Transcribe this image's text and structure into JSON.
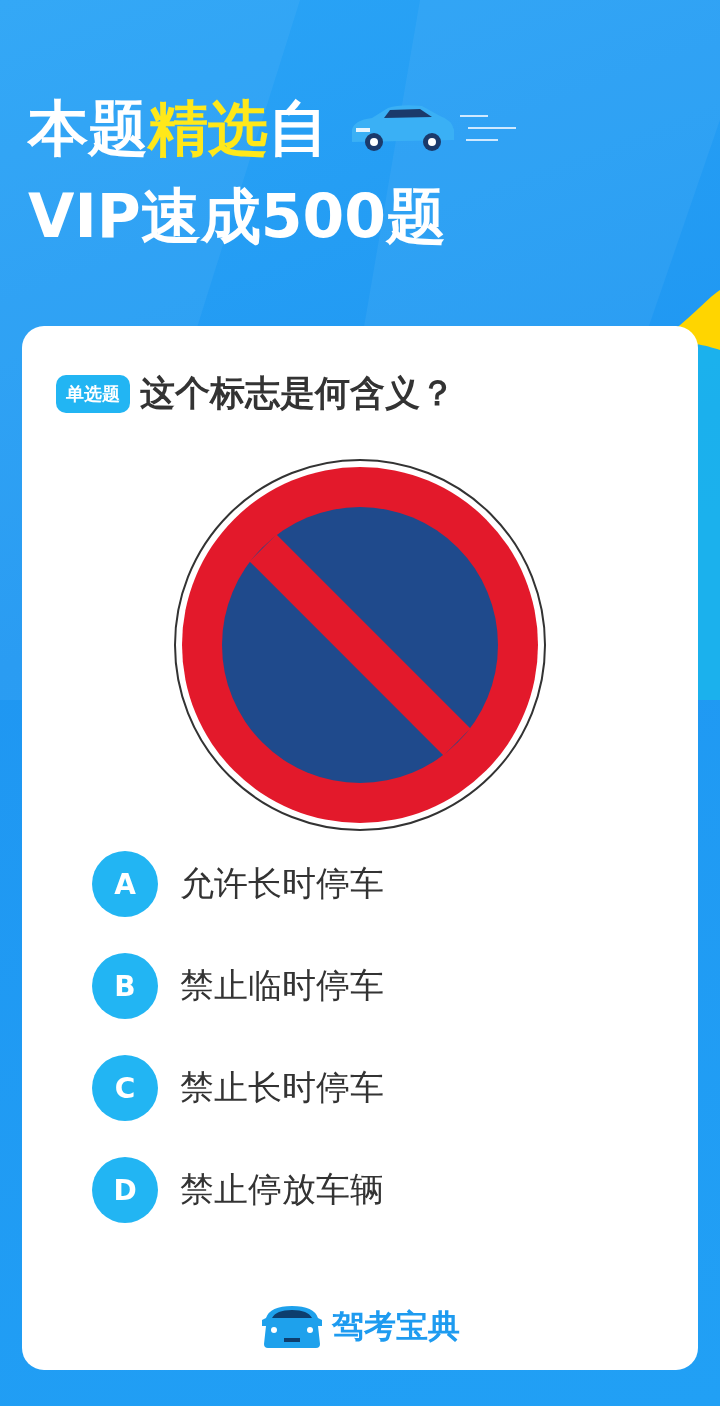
{
  "header": {
    "title_lines": [
      "本题**精选**自",
      "VIP速成500题"
    ]
  },
  "question": {
    "type_badge": "单选题",
    "text": "这个标志是何含义？"
  },
  "options": [
    {
      "letter": "A",
      "text": "允许长时停车",
      "selected": false
    },
    {
      "letter": "B",
      "text": "禁止临时停车",
      "selected": false
    },
    {
      "letter": "C",
      "text": "禁止长时停车",
      "selected": false
    },
    {
      "letter": "D",
      "text": "禁止停放车辆",
      "selected": false
    }
  ],
  "footer": {
    "brand": "驾考宝典"
  }
}
